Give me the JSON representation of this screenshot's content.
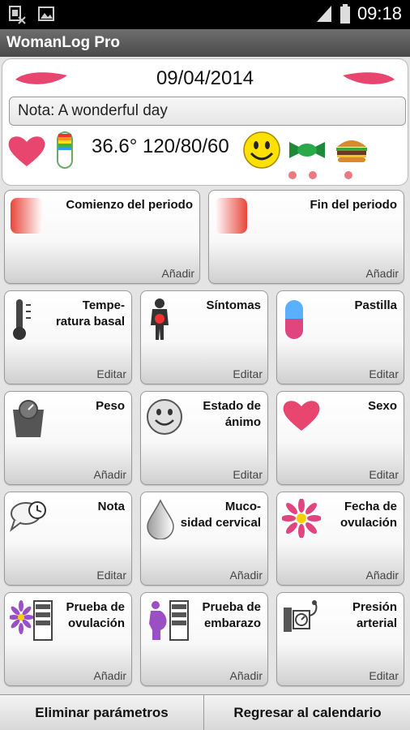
{
  "status_bar": {
    "time": "09:18",
    "icons": [
      "sim-error-icon",
      "image-notification-icon",
      "signal-icon",
      "battery-icon"
    ]
  },
  "app": {
    "title": "WomanLog Pro"
  },
  "day": {
    "date": "09/04/2014",
    "note": "Nota: A wonderful day",
    "vitals": "36.6° 120/80/60",
    "summary_icons": [
      "heart-icon",
      "pill-icon",
      "smiley-icon",
      "candy-icon",
      "burger-icon"
    ]
  },
  "tiles": [
    {
      "label": "Comienzo del periodo",
      "action": "Añadir",
      "icon": "period-start-icon"
    },
    {
      "label": "Fin del periodo",
      "action": "Añadir",
      "icon": "period-end-icon"
    },
    {
      "label": "Tempe-\nratura basal",
      "action": "Editar",
      "icon": "thermometer-icon"
    },
    {
      "label": "Síntomas",
      "action": "Editar",
      "icon": "body-symptom-icon"
    },
    {
      "label": "Pastilla",
      "action": "Editar",
      "icon": "pill-capsule-icon"
    },
    {
      "label": "Peso",
      "action": "Añadir",
      "icon": "scale-icon"
    },
    {
      "label": "Estado de\nánimo",
      "action": "Editar",
      "icon": "mood-smiley-icon"
    },
    {
      "label": "Sexo",
      "action": "Editar",
      "icon": "heart-icon"
    },
    {
      "label": "Nota",
      "action": "Editar",
      "icon": "note-bubble-icon"
    },
    {
      "label": "Muco-\nsidad cervical",
      "action": "Añadir",
      "icon": "drop-icon"
    },
    {
      "label": "Fecha de\novulación",
      "action": "Añadir",
      "icon": "flower-icon"
    },
    {
      "label": "Prueba de\novulación",
      "action": "Añadir",
      "icon": "ovulation-test-icon"
    },
    {
      "label": "Prueba de\nembarazo",
      "action": "Añadir",
      "icon": "pregnancy-test-icon"
    },
    {
      "label": "Presión\narterial",
      "action": "Editar",
      "icon": "blood-pressure-icon"
    }
  ],
  "bottom": {
    "delete_label": "Eliminar parámetros",
    "back_label": "Regresar al calendario"
  },
  "colors": {
    "accent_pink": "#e8456f",
    "dot_pink": "#e87a80"
  }
}
